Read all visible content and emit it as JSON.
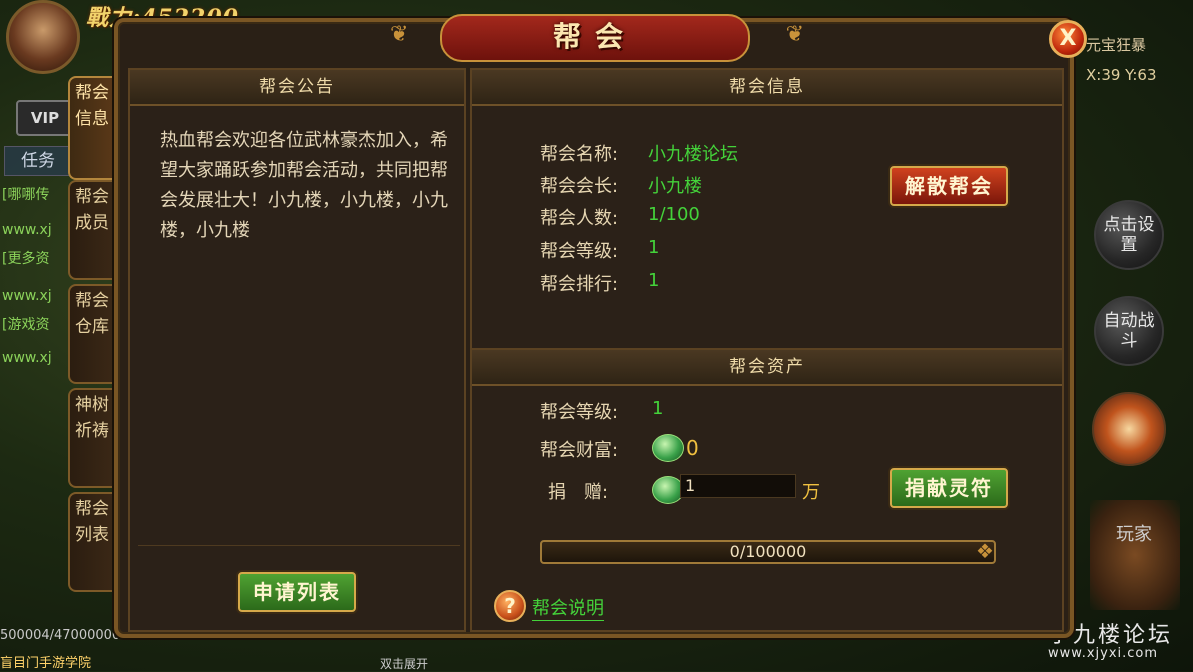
{
  "hud": {
    "power_text": "戰力:452200",
    "top_right_label": "元宝狂暴",
    "coords": "X:39 Y:63",
    "vip_label": "VIP",
    "task_label": "任务",
    "chat_lines": [
      "[哪哪传",
      "www.xj",
      "[更多资",
      "www.xj",
      "[游戏资",
      "www.xj"
    ],
    "bottom_exp": "500004/47000000",
    "bottom_school": "盲目门手游学院",
    "bottom_mid": "双击展开",
    "round_buttons": [
      "点击设置",
      "自动战斗"
    ],
    "player_label": "玩家",
    "watermark": "小九楼论坛",
    "watermark_url": "www.xjyxi.com"
  },
  "side_tabs": [
    "帮会信息",
    "帮会成员",
    "帮会仓库",
    "神树祈祷",
    "帮会列表"
  ],
  "window": {
    "title": "帮会",
    "close_label": "X"
  },
  "notice": {
    "header": "帮会公告",
    "text": "热血帮会欢迎各位武林豪杰加入，希望大家踊跃参加帮会活动，共同把帮会发展壮大！小九楼，小九楼，小九楼，小九楼",
    "apply_button": "申请列表"
  },
  "info": {
    "header": "帮会信息",
    "rows": [
      {
        "label": "帮会名称:",
        "value": "小九楼论坛"
      },
      {
        "label": "帮会会长:",
        "value": "小九楼"
      },
      {
        "label": "帮会人数:",
        "value": "1/100"
      },
      {
        "label": "帮会等级:",
        "value": "1"
      },
      {
        "label": "帮会排行:",
        "value": "1"
      }
    ],
    "disband_button": "解散帮会"
  },
  "assets": {
    "header": "帮会资产",
    "level_label": "帮会等级:",
    "level_value": "1",
    "wealth_label": "帮会财富:",
    "wealth_value": "0",
    "donate_label": "捐　赠:",
    "donate_input": "1",
    "donate_unit": "万",
    "donate_button": "捐献灵符",
    "progress_text": "0/100000",
    "progress_fraction": 0,
    "help_label": "帮会说明"
  }
}
